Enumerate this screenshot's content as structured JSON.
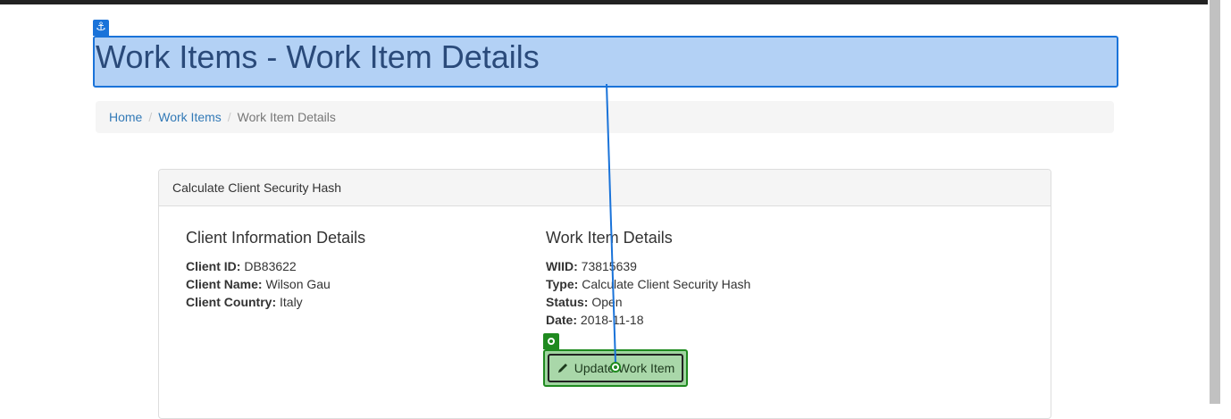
{
  "page": {
    "title": "Work Items - Work Item Details"
  },
  "breadcrumb": {
    "items": [
      "Home",
      "Work Items",
      "Work Item Details"
    ],
    "separator": "/"
  },
  "panel": {
    "heading": "Calculate Client Security Hash",
    "client": {
      "title": "Client Information Details",
      "fields": [
        {
          "label": "Client ID:",
          "value": "DB83622"
        },
        {
          "label": "Client Name:",
          "value": "Wilson Gau"
        },
        {
          "label": "Client Country:",
          "value": "Italy"
        }
      ]
    },
    "work_item": {
      "title": "Work Item Details",
      "fields": [
        {
          "label": "WIID:",
          "value": "73815639"
        },
        {
          "label": "Type:",
          "value": "Calculate Client Security Hash"
        },
        {
          "label": "Status:",
          "value": "Open"
        },
        {
          "label": "Date:",
          "value": "2018-11-18"
        }
      ]
    },
    "update_button_label": "Update Work Item",
    "update_button_icon": "pencil-icon"
  },
  "overlay": {
    "anchor_icon": "anchor-icon",
    "anchor_color": "#1a73d9",
    "target_icon": "target-icon",
    "target_color": "#1f8a1f"
  }
}
